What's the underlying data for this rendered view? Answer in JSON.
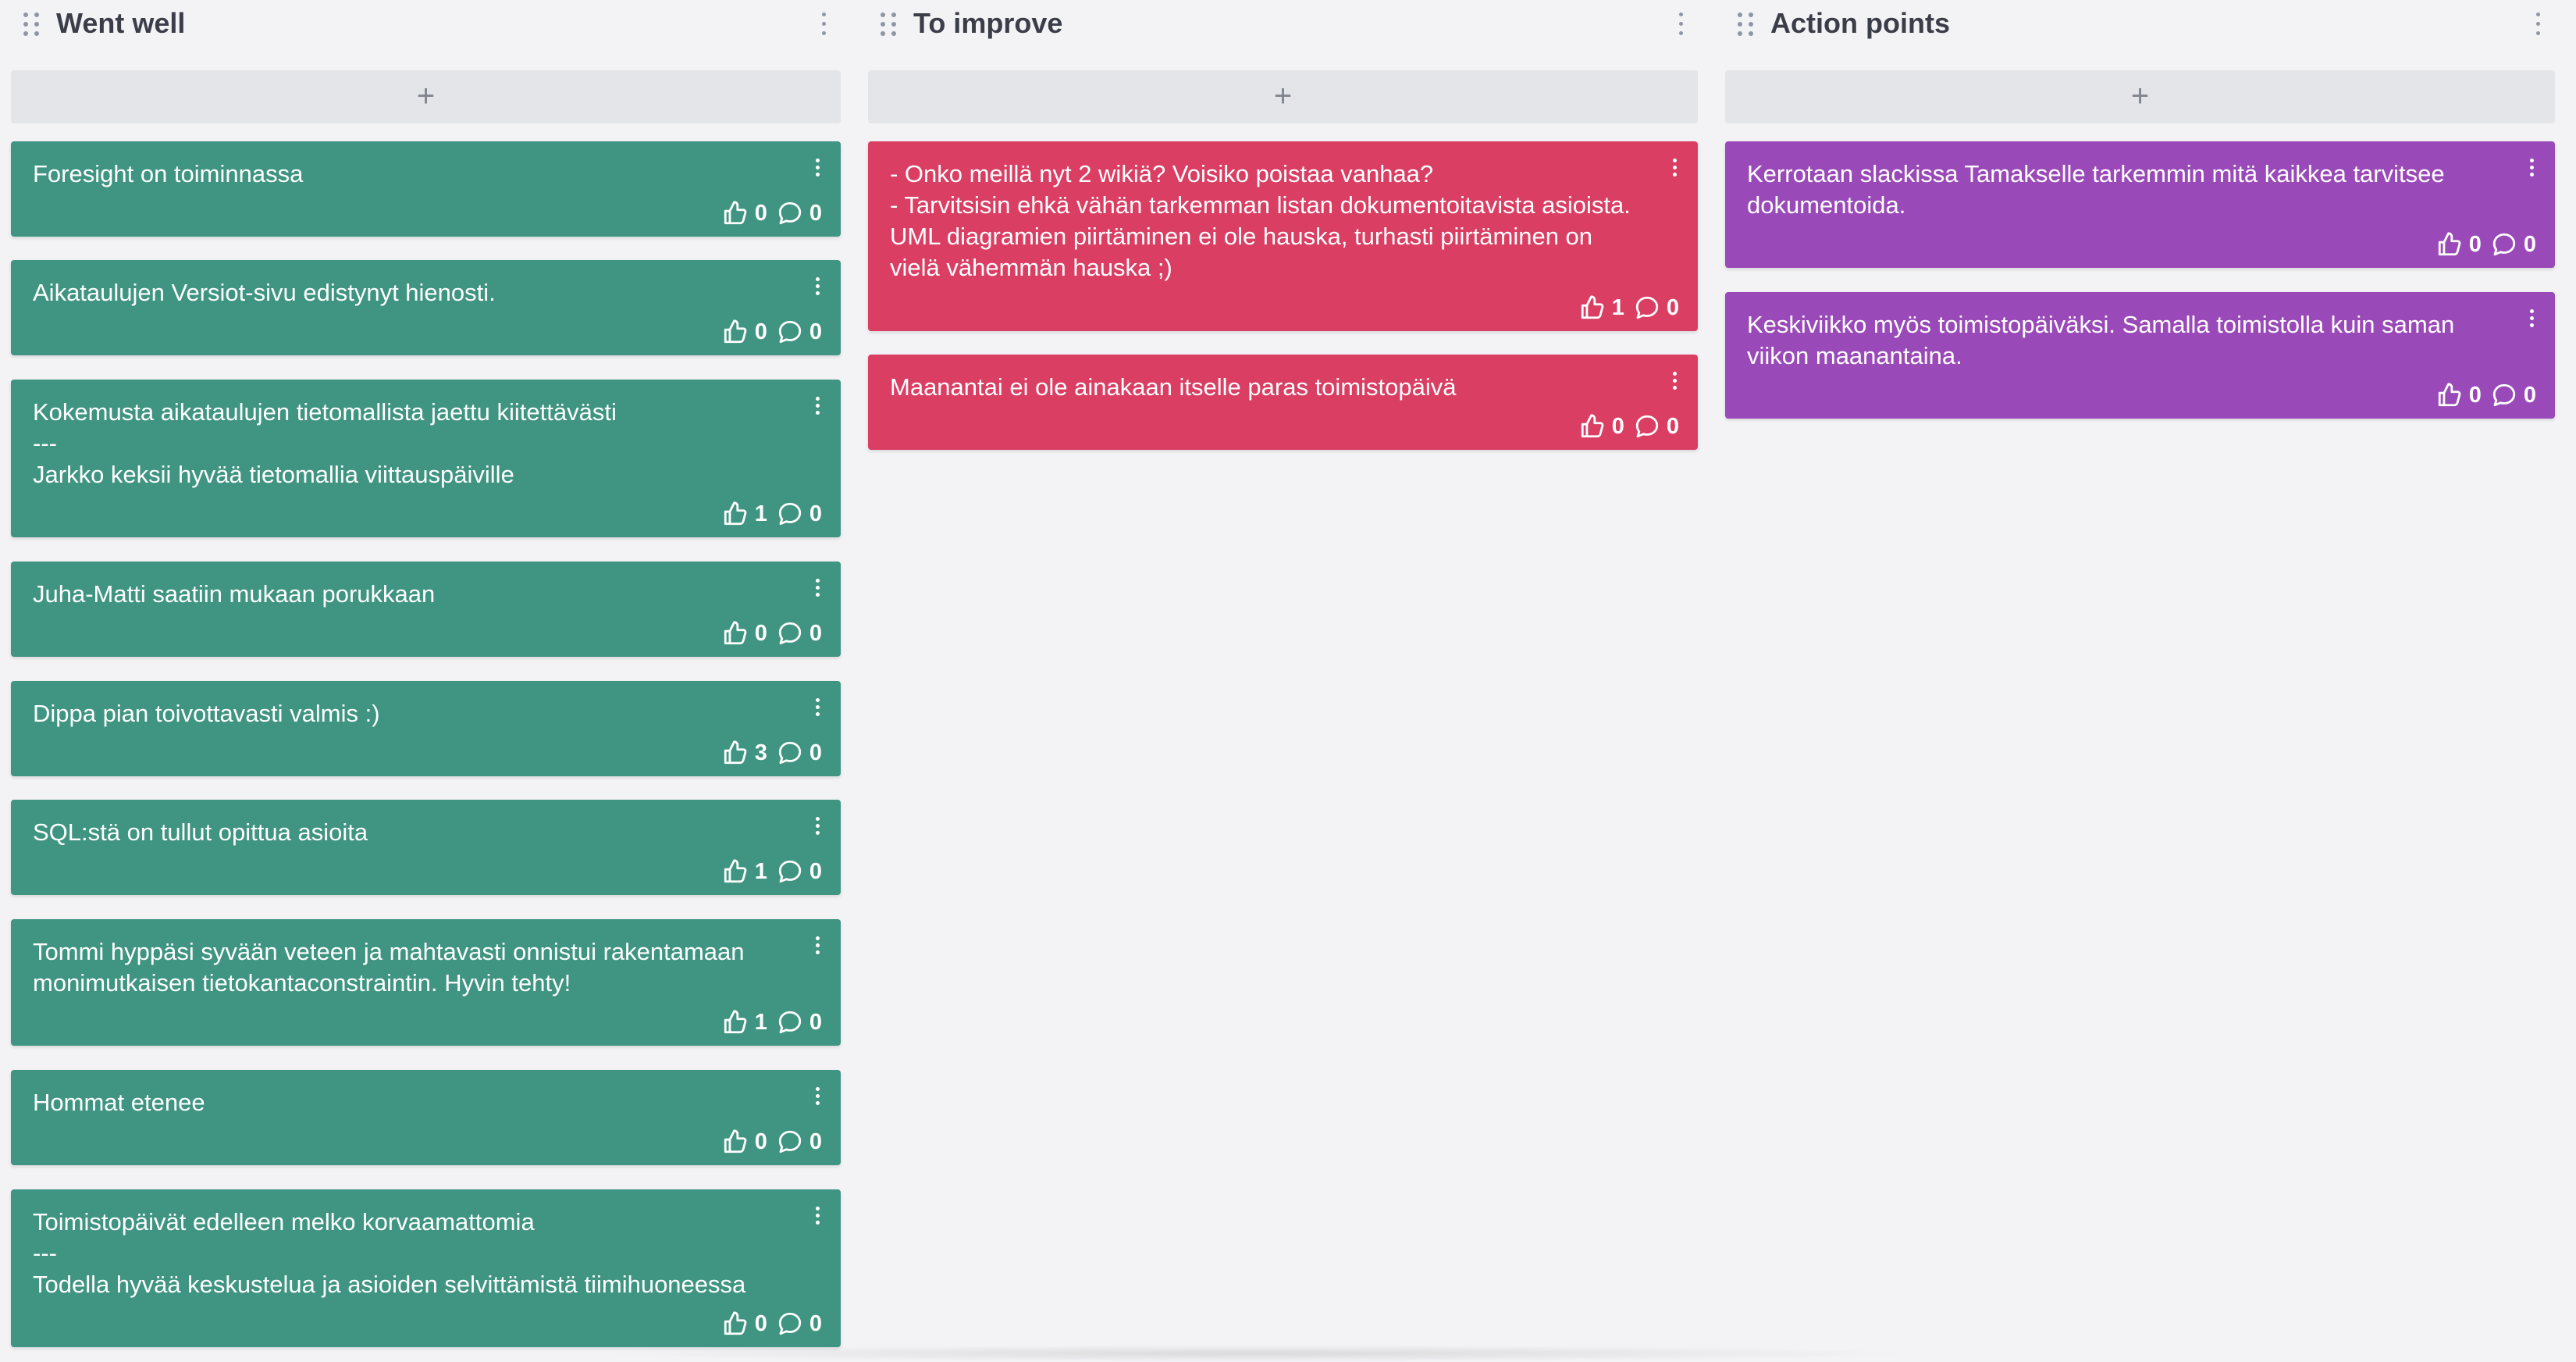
{
  "colors": {
    "went_well": "#3f9482",
    "to_improve": "#da3e63",
    "action_points": "#9a4ab8"
  },
  "icons": {
    "drag": "drag-handle-icon",
    "menu": "more-vertical-icon",
    "add": "plus-icon",
    "vote": "thumbs-up-icon",
    "comment": "comment-icon"
  },
  "columns": [
    {
      "title": "Went well",
      "add_label": "+",
      "cards": [
        {
          "text": "Foresight on toiminnassa",
          "votes": "0",
          "comments": "0"
        },
        {
          "text": "Aikataulujen Versiot-sivu edistynyt hienosti.",
          "votes": "0",
          "comments": "0"
        },
        {
          "text": "Kokemusta aikataulujen tietomallista jaettu kiitettävästi\n---\nJarkko keksii hyvää tietomallia viittauspäiville",
          "votes": "1",
          "comments": "0"
        },
        {
          "text": "Juha-Matti saatiin mukaan porukkaan",
          "votes": "0",
          "comments": "0"
        },
        {
          "text": "Dippa pian toivottavasti valmis :)",
          "votes": "3",
          "comments": "0"
        },
        {
          "text": "SQL:stä on tullut opittua asioita",
          "votes": "1",
          "comments": "0"
        },
        {
          "text": "Tommi hyppäsi syvään veteen ja mahtavasti onnistui rakentamaan monimutkaisen tietokantaconstraintin. Hyvin tehty!",
          "votes": "1",
          "comments": "0"
        },
        {
          "text": "Hommat etenee",
          "votes": "0",
          "comments": "0"
        },
        {
          "text": "Toimistopäivät edelleen melko korvaamattomia\n---\nTodella hyvää keskustelua ja asioiden selvittämistä tiimihuoneessa",
          "votes": "0",
          "comments": "0"
        }
      ]
    },
    {
      "title": "To improve",
      "add_label": "+",
      "cards": [
        {
          "text": "- Onko meillä nyt 2 wikiä? Voisiko poistaa vanhaa?\n- Tarvitsisin ehkä vähän tarkemman listan dokumentoitavista asioista. UML diagramien piirtäminen ei ole hauska, turhasti piirtäminen on vielä vähemmän hauska ;)",
          "votes": "1",
          "comments": "0"
        },
        {
          "text": "Maanantai ei ole ainakaan itselle paras toimistopäivä",
          "votes": "0",
          "comments": "0"
        }
      ]
    },
    {
      "title": "Action points",
      "add_label": "+",
      "cards": [
        {
          "text": "Kerrotaan slackissa Tamakselle tarkemmin mitä kaikkea tarvitsee dokumentoida.",
          "votes": "0",
          "comments": "0"
        },
        {
          "text": "Keskiviikko myös toimistopäiväksi. Samalla toimistolla kuin saman viikon maanantaina.",
          "votes": "0",
          "comments": "0"
        }
      ]
    }
  ]
}
